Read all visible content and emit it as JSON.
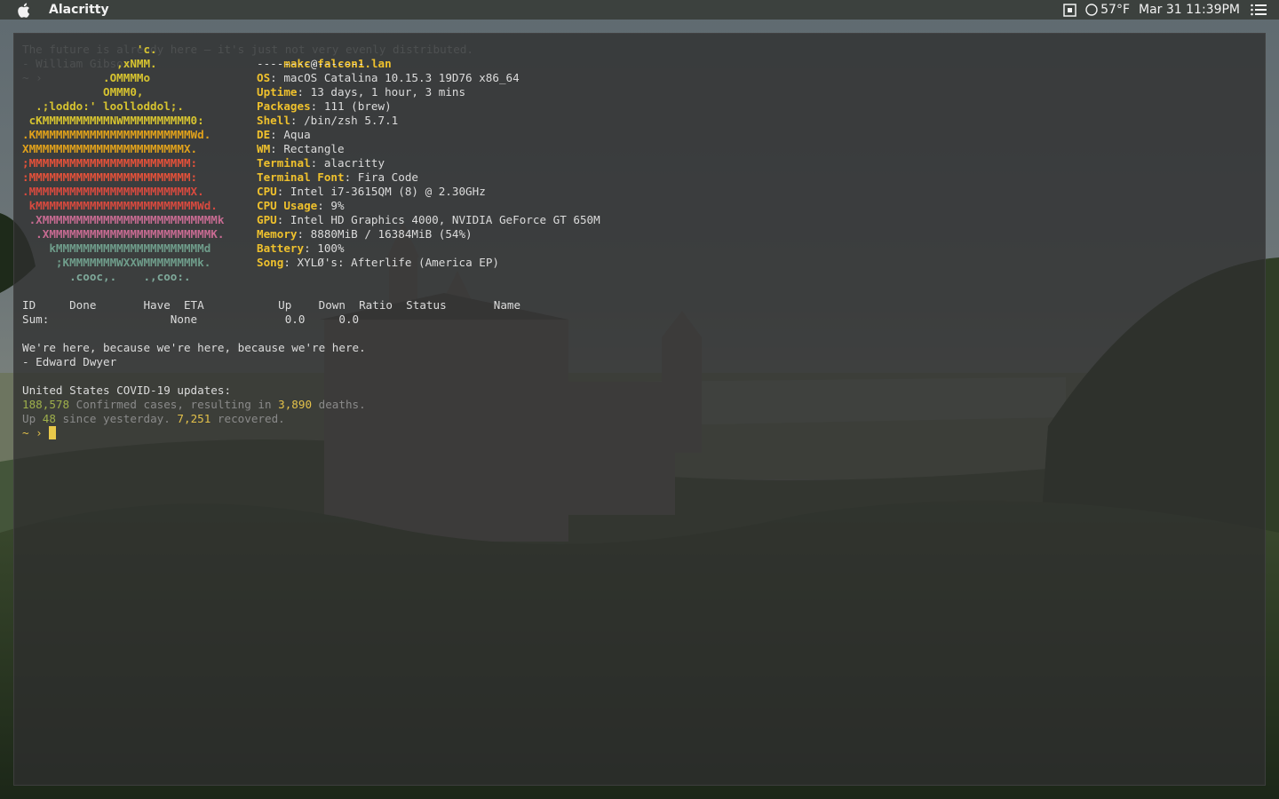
{
  "menubar": {
    "app_name": "Alacritty",
    "temperature": "57°F",
    "datetime": "Mar 31 11:39PM"
  },
  "terminal": {
    "ghost_lines": [
      "The future is already here — it's just not very evenly distributed.",
      "- William Gibson",
      "~ ›"
    ],
    "logo": [
      "                 'c.",
      "              ,xNMM.",
      "            .OMMMMo",
      "            OMMM0,",
      "  .;loddo:' loolloddol;.",
      " cKMMMMMMMMMMNWMMMMMMMMMM0:",
      ".KMMMMMMMMMMMMMMMMMMMMMMMWd.",
      "XMMMMMMMMMMMMMMMMMMMMMMMX.",
      ";MMMMMMMMMMMMMMMMMMMMMMMM:",
      ":MMMMMMMMMMMMMMMMMMMMMMMM:",
      ".MMMMMMMMMMMMMMMMMMMMMMMMX.",
      " kMMMMMMMMMMMMMMMMMMMMMMMMWd.",
      " .XMMMMMMMMMMMMMMMMMMMMMMMMMMk",
      "  .XMMMMMMMMMMMMMMMMMMMMMMMMK.",
      "    kMMMMMMMMMMMMMMMMMMMMMMd",
      "     ;KMMMMMMMWXXWMMMMMMMMk.",
      "       .cooc,.    .,coo:."
    ],
    "user": "makc",
    "at": "@",
    "host": "falcon1.lan",
    "separator": "----------------",
    "info": [
      {
        "key": "OS",
        "value": "macOS Catalina 10.15.3 19D76 x86_64"
      },
      {
        "key": "Uptime",
        "value": "13 days, 1 hour, 3 mins"
      },
      {
        "key": "Packages",
        "value": "111 (brew)"
      },
      {
        "key": "Shell",
        "value": "/bin/zsh 5.7.1"
      },
      {
        "key": "DE",
        "value": "Aqua"
      },
      {
        "key": "WM",
        "value": "Rectangle"
      },
      {
        "key": "Terminal",
        "value": "alacritty"
      },
      {
        "key": "Terminal Font",
        "value": "Fira Code"
      },
      {
        "key": "CPU",
        "value": "Intel i7-3615QM (8) @ 2.30GHz"
      },
      {
        "key": "CPU Usage",
        "value": "9%"
      },
      {
        "key": "GPU",
        "value": "Intel HD Graphics 4000, NVIDIA GeForce GT 650M"
      },
      {
        "key": "Memory",
        "value": "8880MiB / 16384MiB (54%)"
      },
      {
        "key": "Battery",
        "value": "100%"
      },
      {
        "key": "Song",
        "value": "XYLØ's: Afterlife (America EP)"
      }
    ],
    "torrent_header": "ID     Done       Have  ETA           Up    Down  Ratio  Status       Name",
    "torrent_sum": "Sum:                  None             0.0     0.0",
    "quote_line1": "We're here, because we're here, because we're here.",
    "quote_line2": "- Edward Dwyer",
    "covid_title": "United States COVID-19 updates:",
    "covid_confirmed": "188,578",
    "covid_text1": " Confirmed cases, resulting in ",
    "covid_deaths": "3,890",
    "covid_text2": " deaths.",
    "covid_up_prefix": "Up ",
    "covid_up": "48",
    "covid_up_text": " since yesterday. ",
    "covid_recovered": "7,251",
    "covid_recovered_text": " recovered.",
    "prompt": "~ ›"
  }
}
